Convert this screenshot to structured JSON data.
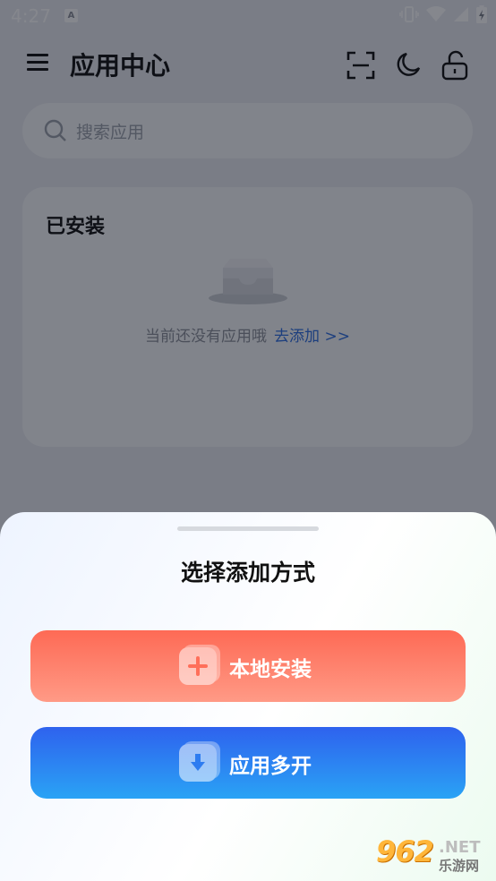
{
  "status_bar": {
    "time": "4:27",
    "notif_icon": "A"
  },
  "app_bar": {
    "title": "应用中心",
    "icons": [
      "menu-icon",
      "scan-icon",
      "moon-icon",
      "unlock-icon"
    ]
  },
  "search": {
    "placeholder": "搜索应用"
  },
  "installed": {
    "title": "已安装",
    "empty_text": "当前还没有应用哦",
    "add_link": "去添加 >>"
  },
  "sheet": {
    "title": "选择添加方式",
    "options": [
      {
        "label": "本地安装",
        "icon": "plus-icon",
        "color": "#fe6a55"
      },
      {
        "label": "应用多开",
        "icon": "download-icon",
        "color": "#2e62ee"
      }
    ]
  },
  "watermark": {
    "number": "962",
    "suffix": ".NET",
    "name": "乐游网"
  },
  "colors": {
    "link": "#2f6fe0",
    "orange": "#fe6a55",
    "blue": "#2e62ee"
  }
}
